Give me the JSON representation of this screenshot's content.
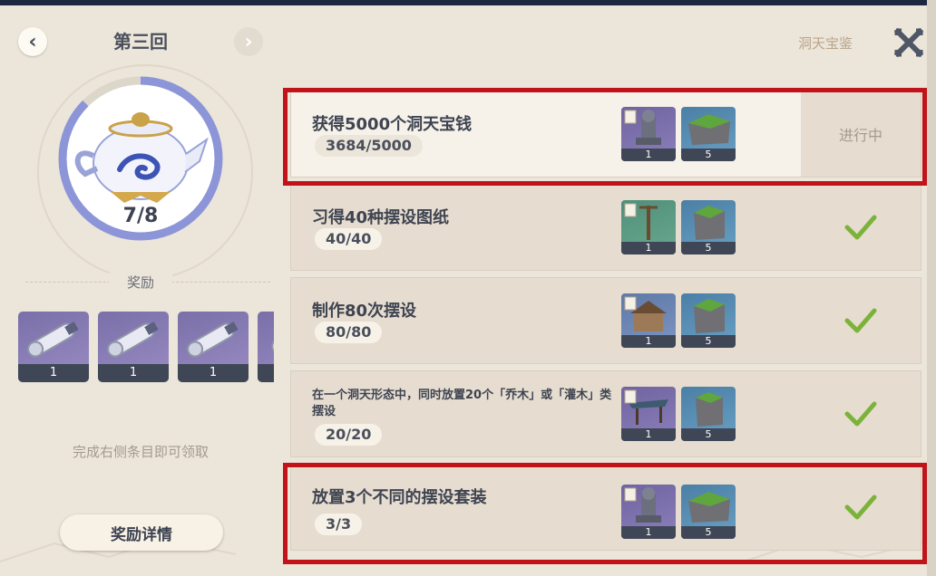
{
  "header": {
    "round_title": "第三回",
    "codex_label": "洞天宝鉴"
  },
  "progress": {
    "text": "7/8",
    "fraction": 0.875
  },
  "rewards": {
    "label": "奖励",
    "items": [
      {
        "icon": "scroll-icon",
        "count": "1"
      },
      {
        "icon": "scroll-icon",
        "count": "1"
      },
      {
        "icon": "scroll-icon",
        "count": "1"
      },
      {
        "icon": "scroll-icon",
        "count": ""
      }
    ],
    "hint": "完成右侧条目即可领取",
    "detail_button": "奖励详情"
  },
  "tasks": [
    {
      "title": "获得5000个洞天宝钱",
      "progress": "3684/5000",
      "status": "进行中",
      "done": false,
      "rewards": [
        {
          "icon": "statue-furnishing-icon",
          "count": "1"
        },
        {
          "icon": "grass-rock-icon",
          "count": "5"
        }
      ]
    },
    {
      "title": "习得40种摆设图纸",
      "progress": "40/40",
      "status": "",
      "done": true,
      "rewards": [
        {
          "icon": "lamp-post-furnishing-icon",
          "count": "1"
        },
        {
          "icon": "grass-rock-icon",
          "count": "5"
        }
      ]
    },
    {
      "title": "制作80次摆设",
      "progress": "80/80",
      "status": "",
      "done": true,
      "rewards": [
        {
          "icon": "house-furnishing-icon",
          "count": "1"
        },
        {
          "icon": "grass-rock-icon",
          "count": "5"
        }
      ]
    },
    {
      "title": "在一个洞天形态中，同时放置20个「乔木」或「灌木」类摆设",
      "progress": "20/20",
      "status": "",
      "done": true,
      "rewards": [
        {
          "icon": "pavilion-furnishing-icon",
          "count": "1"
        },
        {
          "icon": "grass-rock-icon",
          "count": "5"
        }
      ]
    },
    {
      "title": "放置3个不同的摆设套装",
      "progress": "3/3",
      "status": "",
      "done": true,
      "rewards": [
        {
          "icon": "statue-furnishing-icon",
          "count": "1"
        },
        {
          "icon": "grass-rock-icon",
          "count": "5"
        }
      ]
    }
  ],
  "colors": {
    "highlight": "#c0141a",
    "check": "#7bb33a",
    "ring": "#8c95d8"
  }
}
